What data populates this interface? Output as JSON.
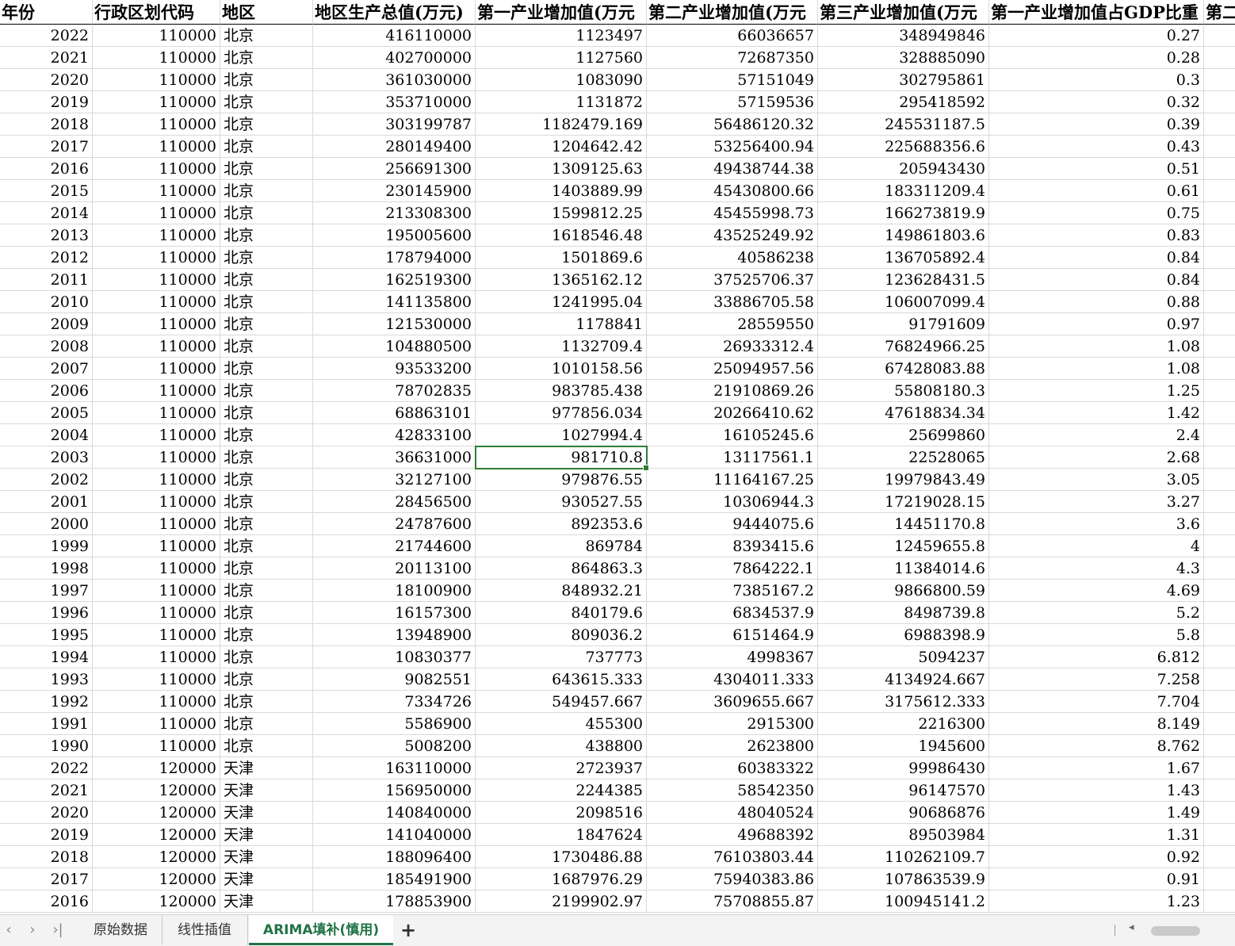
{
  "headers": [
    "年份",
    "行政区划代码",
    "地区",
    "地区生产总值(万元)",
    "第一产业增加值(万元",
    "第二产业增加值(万元",
    "第三产业增加值(万元",
    "第一产业增加值占GDP比重",
    "第二"
  ],
  "rows": [
    [
      "2022",
      "110000",
      "北京",
      "416110000",
      "1123497",
      "66036657",
      "348949846",
      "0.27"
    ],
    [
      "2021",
      "110000",
      "北京",
      "402700000",
      "1127560",
      "72687350",
      "328885090",
      "0.28"
    ],
    [
      "2020",
      "110000",
      "北京",
      "361030000",
      "1083090",
      "57151049",
      "302795861",
      "0.3"
    ],
    [
      "2019",
      "110000",
      "北京",
      "353710000",
      "1131872",
      "57159536",
      "295418592",
      "0.32"
    ],
    [
      "2018",
      "110000",
      "北京",
      "303199787",
      "1182479.169",
      "56486120.32",
      "245531187.5",
      "0.39"
    ],
    [
      "2017",
      "110000",
      "北京",
      "280149400",
      "1204642.42",
      "53256400.94",
      "225688356.6",
      "0.43"
    ],
    [
      "2016",
      "110000",
      "北京",
      "256691300",
      "1309125.63",
      "49438744.38",
      "205943430",
      "0.51"
    ],
    [
      "2015",
      "110000",
      "北京",
      "230145900",
      "1403889.99",
      "45430800.66",
      "183311209.4",
      "0.61"
    ],
    [
      "2014",
      "110000",
      "北京",
      "213308300",
      "1599812.25",
      "45455998.73",
      "166273819.9",
      "0.75"
    ],
    [
      "2013",
      "110000",
      "北京",
      "195005600",
      "1618546.48",
      "43525249.92",
      "149861803.6",
      "0.83"
    ],
    [
      "2012",
      "110000",
      "北京",
      "178794000",
      "1501869.6",
      "40586238",
      "136705892.4",
      "0.84"
    ],
    [
      "2011",
      "110000",
      "北京",
      "162519300",
      "1365162.12",
      "37525706.37",
      "123628431.5",
      "0.84"
    ],
    [
      "2010",
      "110000",
      "北京",
      "141135800",
      "1241995.04",
      "33886705.58",
      "106007099.4",
      "0.88"
    ],
    [
      "2009",
      "110000",
      "北京",
      "121530000",
      "1178841",
      "28559550",
      "91791609",
      "0.97"
    ],
    [
      "2008",
      "110000",
      "北京",
      "104880500",
      "1132709.4",
      "26933312.4",
      "76824966.25",
      "1.08"
    ],
    [
      "2007",
      "110000",
      "北京",
      "93533200",
      "1010158.56",
      "25094957.56",
      "67428083.88",
      "1.08"
    ],
    [
      "2006",
      "110000",
      "北京",
      "78702835",
      "983785.438",
      "21910869.26",
      "55808180.3",
      "1.25"
    ],
    [
      "2005",
      "110000",
      "北京",
      "68863101",
      "977856.034",
      "20266410.62",
      "47618834.34",
      "1.42"
    ],
    [
      "2004",
      "110000",
      "北京",
      "42833100",
      "1027994.4",
      "16105245.6",
      "25699860",
      "2.4"
    ],
    [
      "2003",
      "110000",
      "北京",
      "36631000",
      "981710.8",
      "13117561.1",
      "22528065",
      "2.68"
    ],
    [
      "2002",
      "110000",
      "北京",
      "32127100",
      "979876.55",
      "11164167.25",
      "19979843.49",
      "3.05"
    ],
    [
      "2001",
      "110000",
      "北京",
      "28456500",
      "930527.55",
      "10306944.3",
      "17219028.15",
      "3.27"
    ],
    [
      "2000",
      "110000",
      "北京",
      "24787600",
      "892353.6",
      "9444075.6",
      "14451170.8",
      "3.6"
    ],
    [
      "1999",
      "110000",
      "北京",
      "21744600",
      "869784",
      "8393415.6",
      "12459655.8",
      "4"
    ],
    [
      "1998",
      "110000",
      "北京",
      "20113100",
      "864863.3",
      "7864222.1",
      "11384014.6",
      "4.3"
    ],
    [
      "1997",
      "110000",
      "北京",
      "18100900",
      "848932.21",
      "7385167.2",
      "9866800.59",
      "4.69"
    ],
    [
      "1996",
      "110000",
      "北京",
      "16157300",
      "840179.6",
      "6834537.9",
      "8498739.8",
      "5.2"
    ],
    [
      "1995",
      "110000",
      "北京",
      "13948900",
      "809036.2",
      "6151464.9",
      "6988398.9",
      "5.8"
    ],
    [
      "1994",
      "110000",
      "北京",
      "10830377",
      "737773",
      "4998367",
      "5094237",
      "6.812"
    ],
    [
      "1993",
      "110000",
      "北京",
      "9082551",
      "643615.333",
      "4304011.333",
      "4134924.667",
      "7.258"
    ],
    [
      "1992",
      "110000",
      "北京",
      "7334726",
      "549457.667",
      "3609655.667",
      "3175612.333",
      "7.704"
    ],
    [
      "1991",
      "110000",
      "北京",
      "5586900",
      "455300",
      "2915300",
      "2216300",
      "8.149"
    ],
    [
      "1990",
      "110000",
      "北京",
      "5008200",
      "438800",
      "2623800",
      "1945600",
      "8.762"
    ],
    [
      "2022",
      "120000",
      "天津",
      "163110000",
      "2723937",
      "60383322",
      "99986430",
      "1.67"
    ],
    [
      "2021",
      "120000",
      "天津",
      "156950000",
      "2244385",
      "58542350",
      "96147570",
      "1.43"
    ],
    [
      "2020",
      "120000",
      "天津",
      "140840000",
      "2098516",
      "48040524",
      "90686876",
      "1.49"
    ],
    [
      "2019",
      "120000",
      "天津",
      "141040000",
      "1847624",
      "49688392",
      "89503984",
      "1.31"
    ],
    [
      "2018",
      "120000",
      "天津",
      "188096400",
      "1730486.88",
      "76103803.44",
      "110262109.7",
      "0.92"
    ],
    [
      "2017",
      "120000",
      "天津",
      "185491900",
      "1687976.29",
      "75940383.86",
      "107863539.9",
      "0.91"
    ],
    [
      "2016",
      "120000",
      "天津",
      "178853900",
      "2199902.97",
      "75708855.87",
      "100945141.2",
      "1.23"
    ]
  ],
  "selected_cell": {
    "row": 20,
    "col": 5,
    "value": "981710.8"
  },
  "sheet_tabs": [
    {
      "label": "原始数据",
      "active": false
    },
    {
      "label": "线性插值",
      "active": false
    },
    {
      "label": "ARIMA填补(慎用)",
      "active": true
    }
  ],
  "nav_icons": [
    "chevron-left-icon",
    "chevron-right-icon",
    "last-sheet-icon"
  ],
  "add_sheet_label": "+",
  "colors": {
    "accent": "#217346",
    "selection": "#2e7d32",
    "gridline": "#d9d9d9"
  }
}
